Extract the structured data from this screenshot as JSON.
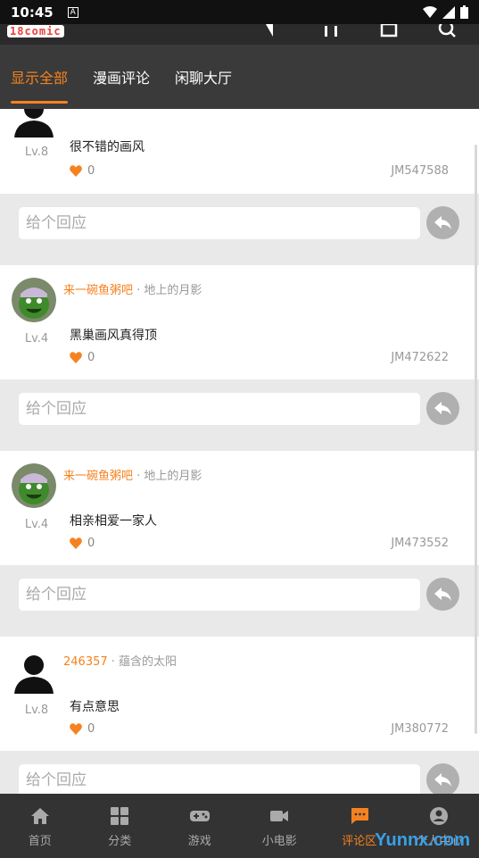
{
  "status_bar": {
    "time": "10:45",
    "a_label": "A"
  },
  "header": {
    "logo_text": "18comic"
  },
  "tabs": [
    {
      "label": "显示全部",
      "active": true
    },
    {
      "label": "漫画评论",
      "active": false
    },
    {
      "label": "闲聊大厅",
      "active": false
    }
  ],
  "comments": [
    {
      "username": "",
      "target": "",
      "level": "Lv.8",
      "text": "很不错的画风",
      "likes": "0",
      "code": "JM547588",
      "avatar": "silhouette"
    },
    {
      "username": "来一碗鱼粥吧",
      "target": "· 地上的月影",
      "level": "Lv.4",
      "text": "黑巢画风真得顶",
      "likes": "0",
      "code": "JM472622",
      "avatar": "green-monster"
    },
    {
      "username": "来一碗鱼粥吧",
      "target": "· 地上的月影",
      "level": "Lv.4",
      "text": "相亲相爱一家人",
      "likes": "0",
      "code": "JM473552",
      "avatar": "green-monster"
    },
    {
      "username": "246357",
      "target": "· 蕴含的太阳",
      "level": "Lv.8",
      "text": "有点意思",
      "likes": "0",
      "code": "JM380772",
      "avatar": "silhouette"
    }
  ],
  "reply": {
    "placeholder": "给个回应"
  },
  "bottom_nav": [
    {
      "label": "首页",
      "icon": "home-icon",
      "active": false
    },
    {
      "label": "分类",
      "icon": "grid-icon",
      "active": false
    },
    {
      "label": "游戏",
      "icon": "gamepad-icon",
      "active": false
    },
    {
      "label": "小电影",
      "icon": "video-icon",
      "active": false
    },
    {
      "label": "评论区",
      "icon": "comment-icon",
      "active": true
    },
    {
      "label": "个人中心",
      "icon": "user-icon",
      "active": false
    }
  ],
  "watermark": "Yunnx.com",
  "colors": {
    "accent": "#f5821f",
    "tabbar": "#3a3a3a",
    "nav": "#333333"
  }
}
